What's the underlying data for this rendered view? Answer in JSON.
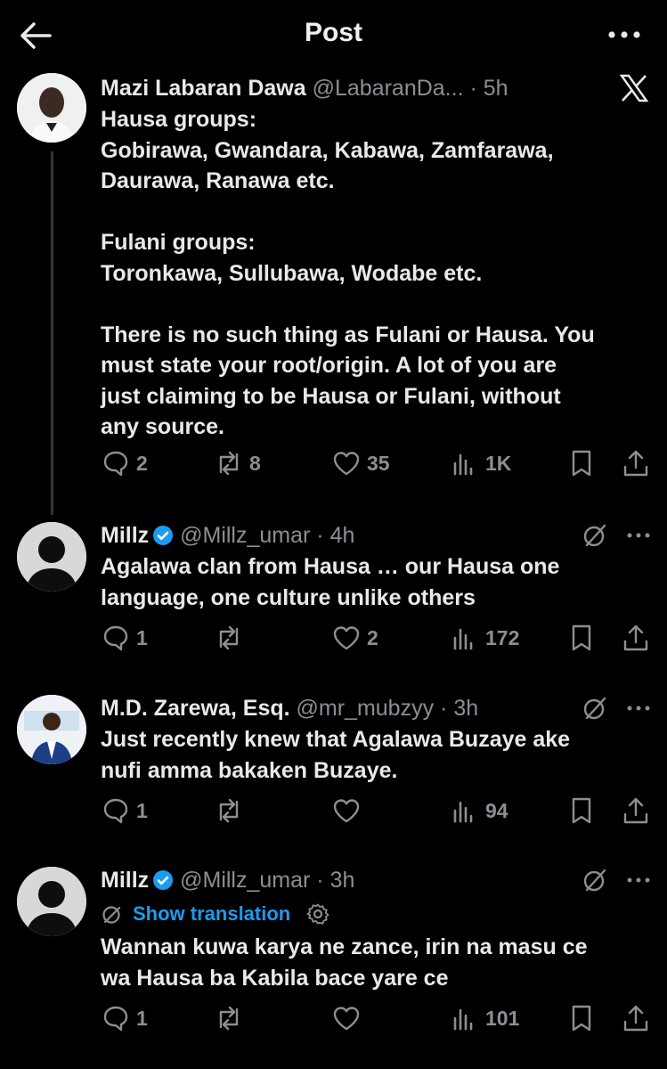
{
  "header": {
    "title": "Post"
  },
  "posts": [
    {
      "name": "Mazi Labaran Dawa",
      "handle": "@LabaranDa...",
      "time": "5h",
      "body": "Hausa groups:\nGobirawa, Gwandara, Kabawa, Zamfarawa,\nDaurawa, Ranawa etc.\n\nFulani groups:\nToronkawa, Sullubawa, Wodabe etc.\n\nThere is no such thing as Fulani or Hausa. You\nmust state your root/origin. A lot of you are\njust claiming to be Hausa or Fulani, without\nany source.",
      "replies": "2",
      "reposts": "8",
      "likes": "35",
      "views": "1K"
    },
    {
      "name": "Millz",
      "handle": "@Millz_umar",
      "time": "4h",
      "body": "Agalawa clan from Hausa … our Hausa one\nlanguage, one culture unlike others",
      "replies": "1",
      "reposts": "",
      "likes": "2",
      "views": "172"
    },
    {
      "name": "M.D. Zarewa, Esq.",
      "handle": "@mr_mubzyy",
      "time": "3h",
      "body": "Just recently knew that Agalawa Buzaye ake\nnufi amma bakaken Buzaye.",
      "replies": "1",
      "reposts": "",
      "likes": "",
      "views": "94"
    },
    {
      "name": "Millz",
      "handle": "@Millz_umar",
      "time": "3h",
      "translation_label": "Show translation",
      "body": "Wannan kuwa karya ne zance, irin na masu ce\nwa Hausa ba Kabila bace yare ce",
      "replies": "1",
      "reposts": "",
      "likes": "",
      "views": "101"
    }
  ],
  "colors": {
    "background": "#000000",
    "text": "#e7e9ea",
    "muted": "#8b8f94",
    "accent": "#1d9bf0"
  }
}
